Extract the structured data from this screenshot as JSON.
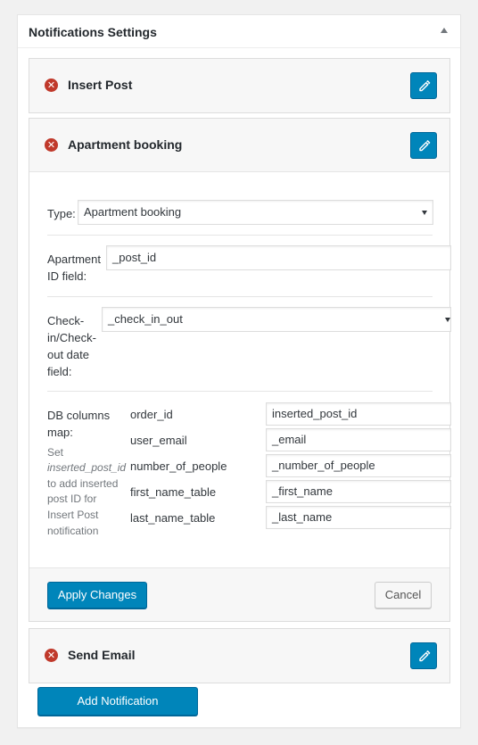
{
  "panel": {
    "title": "Notifications Settings"
  },
  "notifications": [
    {
      "title": "Insert Post"
    },
    {
      "title": "Apartment booking"
    },
    {
      "title": "Send Email"
    }
  ],
  "form": {
    "type_label": "Type:",
    "type_value": "Apartment booking",
    "apartment_label_line1": "Apartment",
    "apartment_label_line2": "ID field:",
    "apartment_value": "_post_id",
    "checkin_label_line1": "Check-",
    "checkin_label_line2": "in/Check-",
    "checkin_label_line3": "out date",
    "checkin_label_line4": "field:",
    "checkin_value": "_check_in_out",
    "db_label_line1": "DB columns",
    "db_label_line2": "map:",
    "db_help_line1": "Set",
    "db_help_em": "inserted_post_id",
    "db_help_line3": "to add inserted",
    "db_help_line4": "post ID for",
    "db_help_line5": "Insert Post",
    "db_help_line6": "notification",
    "columns_map": [
      {
        "key": "order_id",
        "value": "inserted_post_id"
      },
      {
        "key": "user_email",
        "value": "_email"
      },
      {
        "key": "number_of_people",
        "value": "_number_of_people"
      },
      {
        "key": "first_name_table",
        "value": "_first_name"
      },
      {
        "key": "last_name_table",
        "value": "_last_name"
      }
    ]
  },
  "buttons": {
    "apply": "Apply Changes",
    "cancel": "Cancel",
    "add_notification": "Add Notification"
  },
  "icons": {
    "delete": "delete-circle-icon",
    "edit": "pencil-icon",
    "toggle": "caret-up-icon"
  },
  "colors": {
    "primary": "#0085ba",
    "danger": "#c0392b"
  }
}
